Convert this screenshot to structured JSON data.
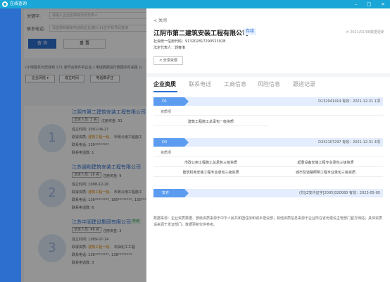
{
  "window": {
    "title": "在线查询",
    "controls": [
      "–",
      "□",
      "×"
    ]
  },
  "background": {
    "search": {
      "keyword_label": "关键字:",
      "keyword_placeholder": "请输入企业名称或法定代表人",
      "phone_label": "联系电话:",
      "phone_placeholder": "请选择有联系电话的企业/输入11位手机号码查询",
      "search_button": "查 询",
      "reset_button": "重 置"
    },
    "result_note": "(小电建共为您找到 171 家符合条件的企业 ( 电话数据进行数据实时采集 ))",
    "sort_buttons": [
      "企业风险 ▾",
      "成立时间",
      "电话数评正"
    ],
    "companies": [
      {
        "num": "1",
        "name": "江阴市第二建筑安装工程有限公司",
        "tag": "法定人员: 3 名",
        "tag2": "注册资金: 31",
        "founded": "成立时间: 2001-06-27",
        "qual_label": "取得资质:",
        "qual_value": "建筑工程一级、",
        "qual_tail": "市政公用工程施工",
        "phone": "联系电话: 139********",
        "phone_more": "联系电话数: 1",
        "badge": ""
      },
      {
        "num": "2",
        "name": "江苏通和建筑安装工程有限公司",
        "tag": "法定人员: 16 名",
        "tag2": "注册资金: 9",
        "founded": "成立时间: 1998-12-26",
        "qual_label": "取得资质:",
        "qual_value": "建筑工程一级、",
        "qual_tail": "市政公用工程施工",
        "phone": "联系电话: 139********, 180********, 135*****",
        "phone_more": "联系电话数: 6",
        "badge": ""
      },
      {
        "num": "3",
        "name": "江苏中润建设集团有限公司",
        "tag": "法定人员: 46 名",
        "tag2": "注册资金: 3",
        "founded": "成立时间: 1989-07-14",
        "qual_label": "取得资质:",
        "qual_value": "建筑工程一级、",
        "qual_tail": "石油化工工程",
        "phone": "联系电话: 136********, 138********",
        "phone_more": "联系电话数: 3",
        "badge": "存续"
      }
    ]
  },
  "drawer": {
    "close_label": "< 关闭",
    "company_name": "江阴市第二建筑安装工程有限公司",
    "status": "存续",
    "update_time": "2021/01/08数据更新",
    "credit_code": "社会统一信用代码：91320281729052302B",
    "legal_rep": "法定代表人：郭春淮",
    "share_button": "分享资源",
    "tabs": [
      "企业资质",
      "联系电话",
      "工商信息",
      "风险信息",
      "跟进记录"
    ],
    "certs": [
      {
        "level": "D1",
        "info": "D132041414  有效：2021-12-31  1项",
        "qual_header": "资质项",
        "items": [
          "建筑工程施工总承包一级资质"
        ]
      },
      {
        "level": "D3",
        "info": "D332107297  有效：2021-12-31  4项",
        "qual_header": "资质项",
        "items": [
          "市政公用工程施工总承包三级资质",
          "起重设备安装工程专业承包三级资质",
          "建筑机电安装工程专业承包三级资质",
          "城市及道路照明工程专业承包三级资质"
        ]
      },
      {
        "level": "安许",
        "info": "(苏)JZ安许证字[2005]020080  有效：2023-05-05",
        "qual_header": "",
        "items": []
      }
    ],
    "footer_note": "数据来源：企业资质数据、部级资质来源于中华人民共和国住房和城乡建设部；其他资质信息来源于企业所在省份建设主管部门官方网站；具体资质请来源于发证部门，数据更新仅供参考。"
  }
}
